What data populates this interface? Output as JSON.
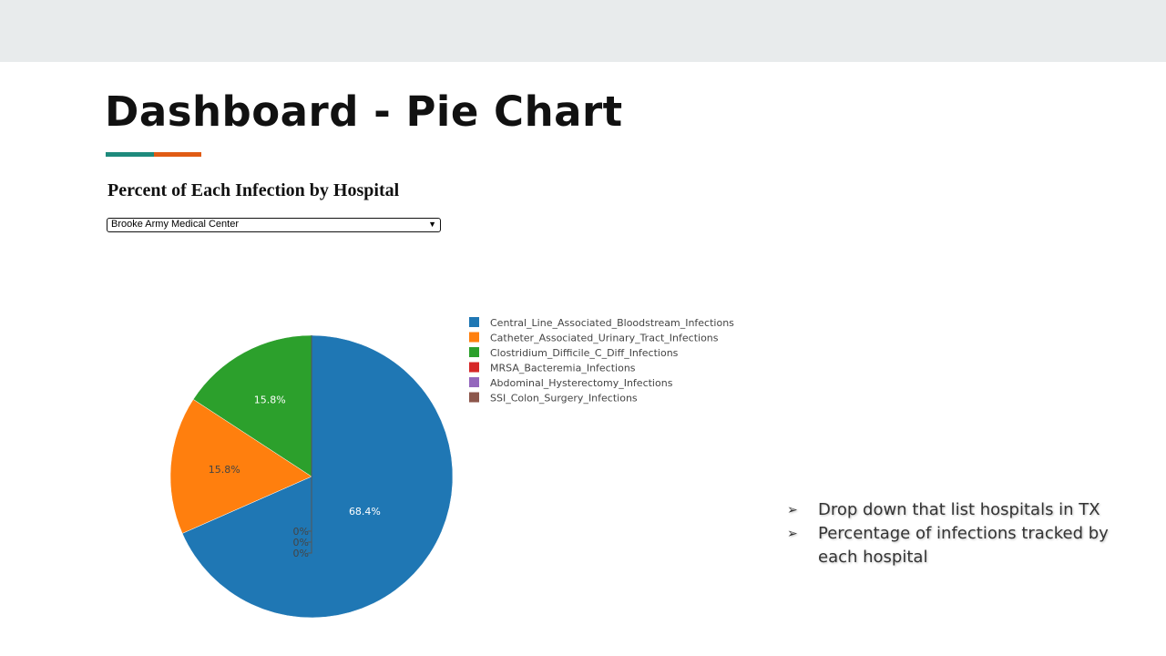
{
  "slide": {
    "title": "Dashboard - Pie Chart"
  },
  "dropdown": {
    "selected": "Brooke Army Medical Center",
    "chevron_icon": "chevron-down-icon"
  },
  "bullets": [
    {
      "text": "Drop down that list hospitals in TX"
    },
    {
      "text": "Percentage of infections tracked by each hospital"
    }
  ],
  "colors": {
    "accent_teal": "#1e8a7c",
    "accent_orange": "#e05b14",
    "band": "#e8ebec"
  },
  "chart_data": {
    "type": "pie",
    "title": "Percent of Each Infection by Hospital",
    "legend_position": "right",
    "slices": [
      {
        "label": "Central_Line_Associated_Bloodstream_Infections",
        "value": 68.4,
        "text": "68.4%",
        "color": "#1f77b4"
      },
      {
        "label": "Catheter_Associated_Urinary_Tract_Infections",
        "value": 15.8,
        "text": "15.8%",
        "color": "#ff7f0e"
      },
      {
        "label": "Clostridium_Difficile_C_Diff_Infections",
        "value": 15.8,
        "text": "15.8%",
        "color": "#2ca02c"
      },
      {
        "label": "MRSA_Bacteremia_Infections",
        "value": 0,
        "text": "0%",
        "color": "#d62728"
      },
      {
        "label": "Abdominal_Hysterectomy_Infections",
        "value": 0,
        "text": "0%",
        "color": "#9467bd"
      },
      {
        "label": "SSI_Colon_Surgery_Infections",
        "value": 0,
        "text": "0%",
        "color": "#8c564b"
      }
    ]
  }
}
